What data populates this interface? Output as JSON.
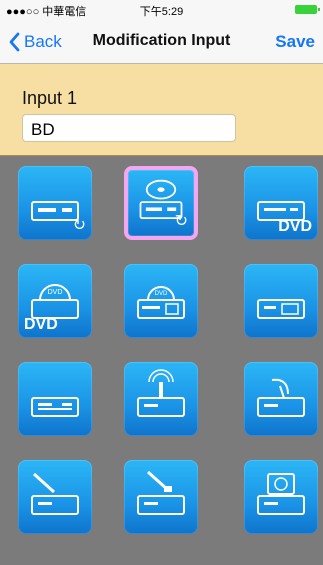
{
  "status_bar": {
    "carrier": "●●●○○ 中華電信",
    "time": "下午5:29"
  },
  "nav": {
    "back_label": "Back",
    "title": "Modification Input",
    "save_label": "Save"
  },
  "input_panel": {
    "label": "Input 1",
    "value": "BD"
  },
  "tiles": [
    {
      "name": "bluray-player-icon",
      "device_type": "bluray-player",
      "selected": false,
      "text": ""
    },
    {
      "name": "bluray-disc-player-icon",
      "device_type": "bluray-disc-player",
      "selected": true,
      "text": ""
    },
    {
      "name": "dvd-player-icon",
      "device_type": "dvd-player",
      "selected": false,
      "text": "DVD"
    },
    {
      "name": "dvd-dome-player-icon",
      "device_type": "dvd-dome",
      "selected": false,
      "text": "DVD"
    },
    {
      "name": "dvd-recorder-icon",
      "device_type": "dvd-recorder",
      "selected": false,
      "text": ""
    },
    {
      "name": "media-player-icon",
      "device_type": "media-player",
      "selected": false,
      "text": ""
    },
    {
      "name": "set-top-box-icon",
      "device_type": "set-top-box",
      "selected": false,
      "text": ""
    },
    {
      "name": "wireless-box-icon",
      "device_type": "wireless-box",
      "selected": false,
      "text": ""
    },
    {
      "name": "satellite-box-icon",
      "device_type": "satellite-box",
      "selected": false,
      "text": ""
    },
    {
      "name": "cable-box-icon",
      "device_type": "cable-box",
      "selected": false,
      "text": ""
    },
    {
      "name": "ethernet-box-icon",
      "device_type": "ethernet-box",
      "selected": false,
      "text": ""
    },
    {
      "name": "hard-drive-icon",
      "device_type": "hard-drive",
      "selected": false,
      "text": ""
    }
  ]
}
